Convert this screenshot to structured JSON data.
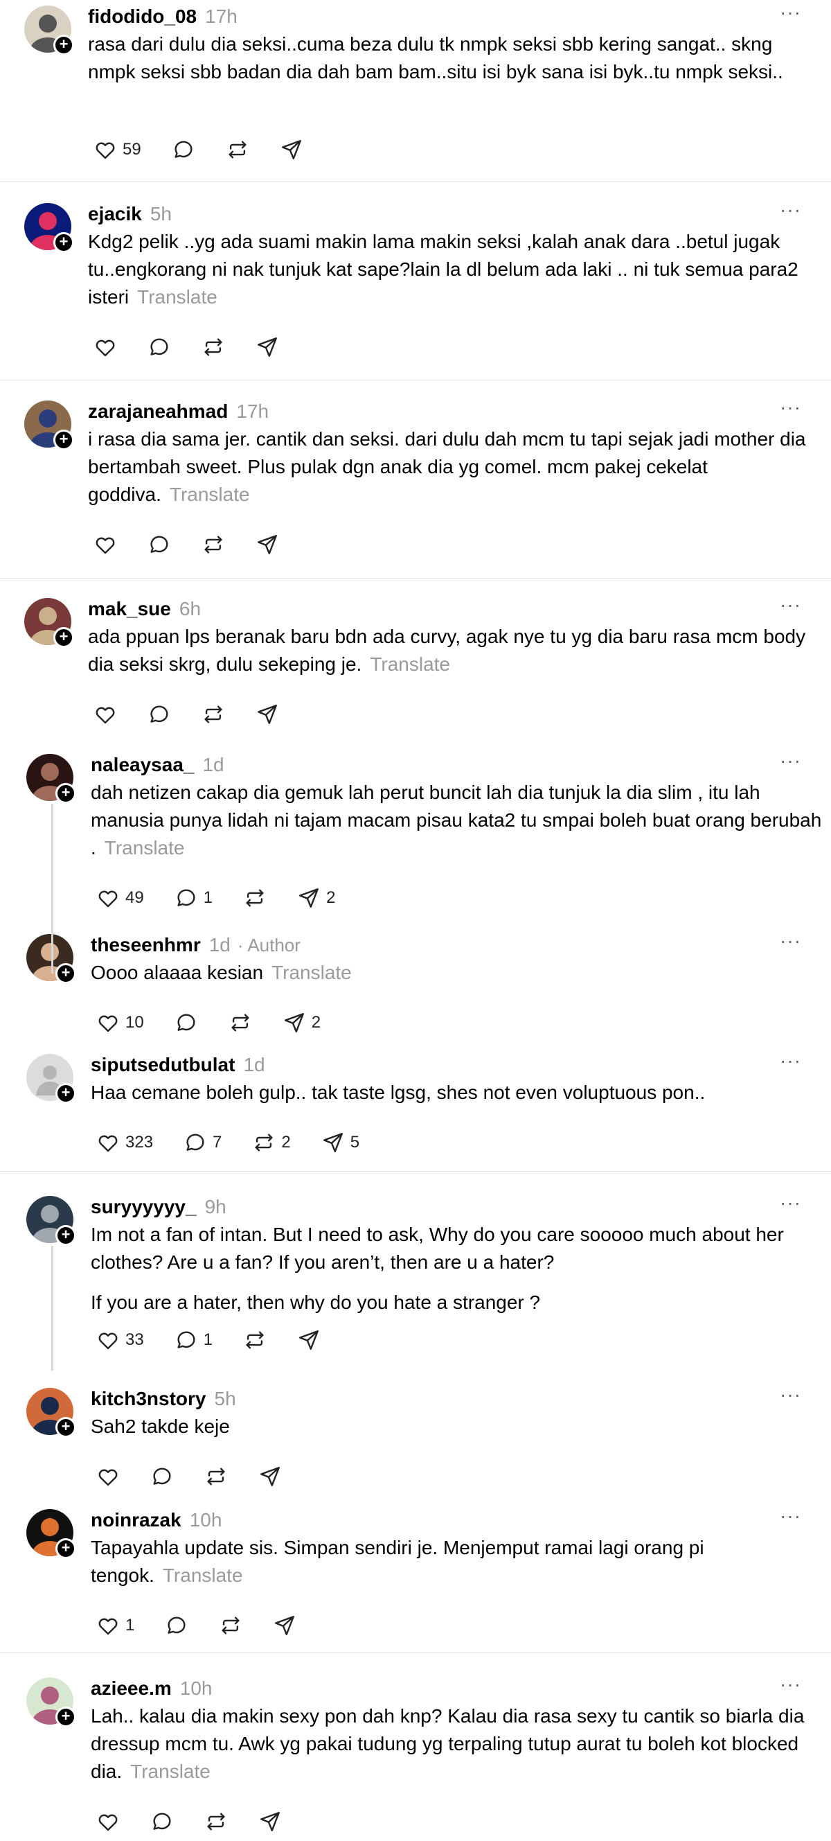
{
  "posts": [
    {
      "username": "fidodido_08",
      "time": "17h",
      "text": "rasa dari dulu dia seksi..cuma beza dulu tk nmpk seksi sbb kering sangat.. skng nmpk seksi sbb badan dia dah bam bam..situ isi byk sana isi byk..tu nmpk seksi..",
      "translate": "",
      "likes": "59",
      "replies": "",
      "reposts": "",
      "shares": ""
    },
    {
      "username": "ejacik",
      "time": "5h",
      "text": "Kdg2 pelik ..yg ada suami makin lama makin seksi ,kalah anak dara ..betul jugak tu..engkorang ni nak tunjuk kat sape?lain la dl belum ada laki .. ni tuk semua para2 isteri",
      "translate": "Translate",
      "likes": "",
      "replies": "",
      "reposts": "",
      "shares": ""
    },
    {
      "username": "zarajaneahmad",
      "time": "17h",
      "text": "i rasa dia sama jer. cantik dan seksi. dari dulu dah mcm tu tapi sejak jadi mother dia bertambah sweet. Plus pulak dgn anak dia yg comel. mcm pakej cekelat goddiva.",
      "translate": "Translate",
      "likes": "",
      "replies": "",
      "reposts": "",
      "shares": ""
    },
    {
      "username": "mak_sue",
      "time": "6h",
      "text": "ada ppuan lps beranak baru bdn ada curvy, agak nye tu yg dia baru rasa mcm body dia seksi skrg, dulu sekeping je.",
      "translate": "Translate",
      "likes": "",
      "replies": "",
      "reposts": "",
      "shares": ""
    },
    {
      "username": "naleaysaa_",
      "time": "1d",
      "text": "dah netizen cakap dia gemuk lah perut buncit lah dia tunjuk la dia slim , itu lah manusia punya lidah ni tajam macam pisau kata2 tu smpai boleh buat orang berubah .",
      "translate": "Translate",
      "likes": "49",
      "replies": "1",
      "reposts": "",
      "shares": "2"
    },
    {
      "username": "theseenhmr",
      "time": "1d",
      "author": "· Author",
      "text": "Oooo alaaaa kesian",
      "translate": "Translate",
      "likes": "10",
      "replies": "",
      "reposts": "",
      "shares": "2"
    },
    {
      "username": "siputsedutbulat",
      "time": "1d",
      "text": "Haa cemane boleh gulp.. tak taste lgsg, shes not even voluptuous pon..",
      "translate": "",
      "likes": "323",
      "replies": "7",
      "reposts": "2",
      "shares": "5"
    },
    {
      "username": "suryyyyyy_",
      "time": "9h",
      "text": "Im not a fan of intan. But I need to ask, Why do you care sooooo much about her clothes? Are u a fan? If you aren’t, then are u a hater?",
      "text2": "If you are a hater, then why do you hate a stranger ?",
      "translate": "",
      "likes": "33",
      "replies": "1",
      "reposts": "",
      "shares": ""
    },
    {
      "username": "kitch3nstory",
      "time": "5h",
      "text": "Sah2 takde keje",
      "translate": "",
      "likes": "",
      "replies": "",
      "reposts": "",
      "shares": ""
    },
    {
      "username": "noinrazak",
      "time": "10h",
      "text": "Tapayahla update sis. Simpan sendiri je. Menjemput ramai lagi orang pi tengok.",
      "translate": "Translate",
      "likes": "1",
      "replies": "",
      "reposts": "",
      "shares": ""
    },
    {
      "username": "azieee.m",
      "time": "10h",
      "text": "Lah.. kalau dia makin sexy pon dah knp? Kalau dia rasa sexy tu cantik so biarla dia dressup mcm tu. Awk yg pakai tudung yg terpaling tutup aurat tu boleh kot blocked dia.",
      "translate": "Translate",
      "likes": "",
      "replies": "",
      "reposts": "",
      "shares": ""
    }
  ],
  "icons": {
    "more": "more-icon",
    "like": "heart-icon",
    "reply": "comment-icon",
    "repost": "repost-icon",
    "share": "send-icon"
  },
  "more_glyph": "···"
}
